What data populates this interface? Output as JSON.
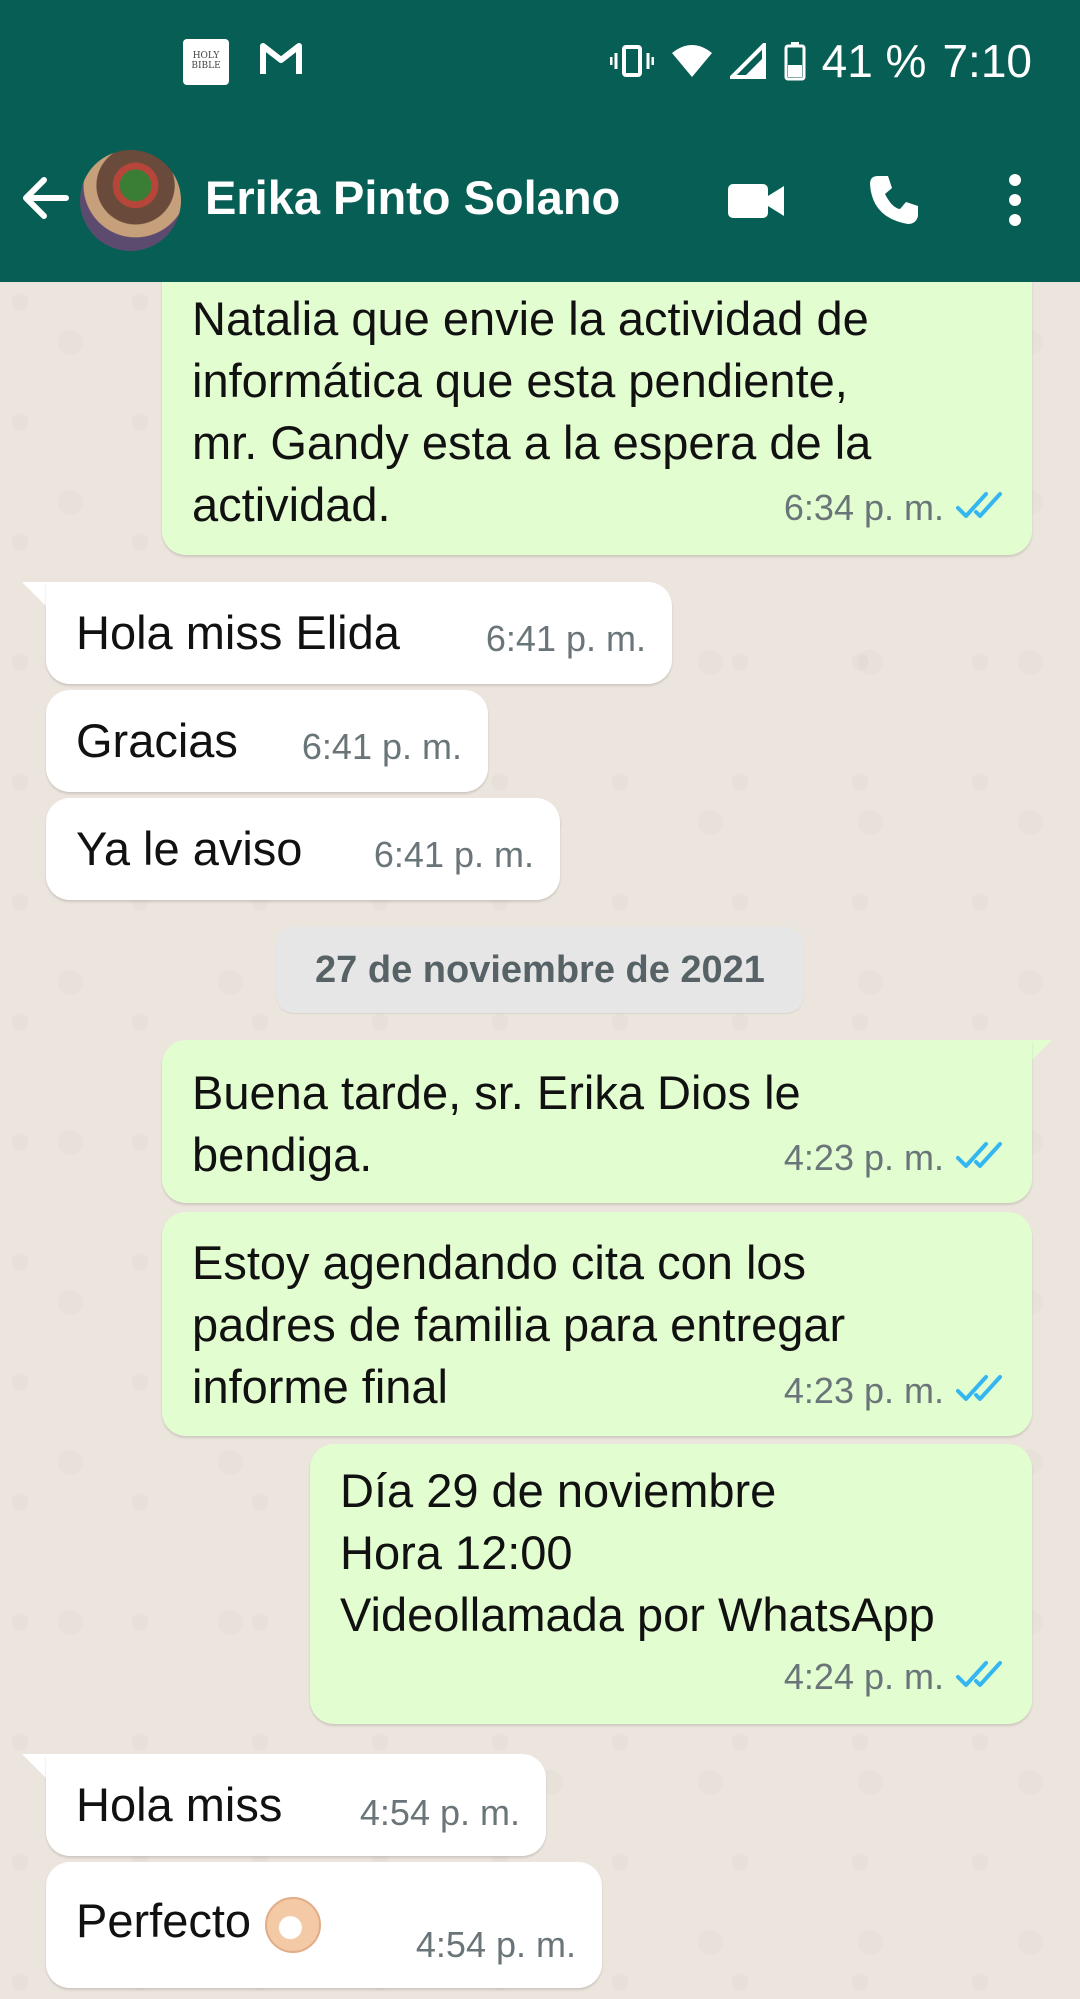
{
  "status_bar": {
    "battery": "41 %",
    "time": "7:10",
    "bible_icon_label": "HOLY BIBLE"
  },
  "header": {
    "contact_name": "Erika Pinto Solano"
  },
  "messages": [
    {
      "direction": "out",
      "text": "Natalia que envie la  actividad de\ninformática que esta pendiente,\nmr. Gandy esta a la espera de la\nactividad.",
      "time": "6:34 p. m.",
      "status": "read"
    },
    {
      "direction": "in",
      "text": "Hola miss Elida",
      "time": "6:41 p. m."
    },
    {
      "direction": "in",
      "text": "Gracias",
      "time": "6:41 p. m."
    },
    {
      "direction": "in",
      "text": "Ya le aviso",
      "time": "6:41 p. m."
    },
    {
      "direction": "out",
      "text": "Buena tarde, sr. Erika Dios le\nbendiga.",
      "time": "4:23 p. m.",
      "status": "read"
    },
    {
      "direction": "out",
      "text": "Estoy agendando cita con los\npadres de familia para entregar\ninforme final",
      "time": "4:23 p. m.",
      "status": "read"
    },
    {
      "direction": "out",
      "text": "Día 29 de noviembre\nHora 12:00\nVideollamada por WhatsApp",
      "time": "4:24 p. m.",
      "status": "read"
    },
    {
      "direction": "in",
      "text": "Hola miss",
      "time": "4:54 p. m."
    },
    {
      "direction": "in",
      "text": "Perfecto",
      "time": "4:54 p. m.",
      "emoji": "ok-hand"
    }
  ],
  "date_separator": "27 de noviembre de 2021",
  "colors": {
    "header": "#075e54",
    "outgoing_bubble": "#e2fdd0",
    "incoming_bubble": "#ffffff",
    "read_ticks": "#34b7f1",
    "chat_background": "#ece5dd"
  }
}
